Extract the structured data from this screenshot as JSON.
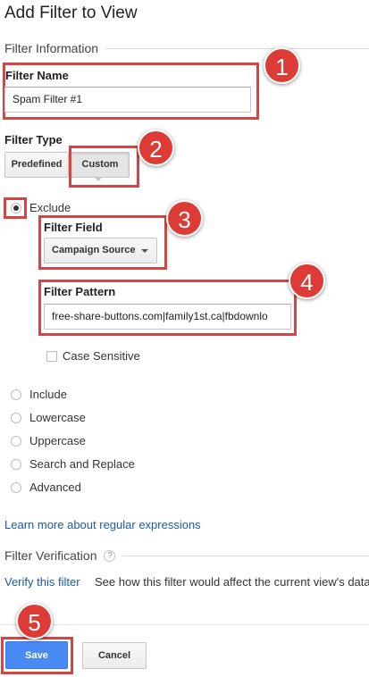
{
  "page": {
    "title": "Add Filter to View"
  },
  "filter_information": {
    "section_label": "Filter Information",
    "name_label": "Filter Name",
    "name_value": "Spam Filter #1"
  },
  "filter_type": {
    "label": "Filter Type",
    "predefined_label": "Predefined",
    "custom_label": "Custom",
    "selected": "Custom"
  },
  "custom_options": {
    "exclude_label": "Exclude",
    "selected": "Exclude",
    "filter_field_label": "Filter Field",
    "filter_field_value": "Campaign Source",
    "filter_pattern_label": "Filter Pattern",
    "filter_pattern_value": "free-share-buttons.com|family1st.ca|fbdownlo",
    "case_sensitive_label": "Case Sensitive",
    "case_sensitive_checked": false,
    "other_options": [
      "Include",
      "Lowercase",
      "Uppercase",
      "Search and Replace",
      "Advanced"
    ]
  },
  "learn_more_link": "Learn more about regular expressions",
  "verification": {
    "section_label": "Filter Verification",
    "help_glyph": "?",
    "verify_link": "Verify this filter",
    "description": "See how this filter would affect the current view's data"
  },
  "actions": {
    "save_label": "Save",
    "cancel_label": "Cancel"
  },
  "annotations": [
    "1",
    "2",
    "3",
    "4",
    "5"
  ],
  "colors": {
    "annotation_red": "#dd3b36",
    "save_blue": "#4a8af4",
    "link_blue": "#1a5aa8"
  }
}
